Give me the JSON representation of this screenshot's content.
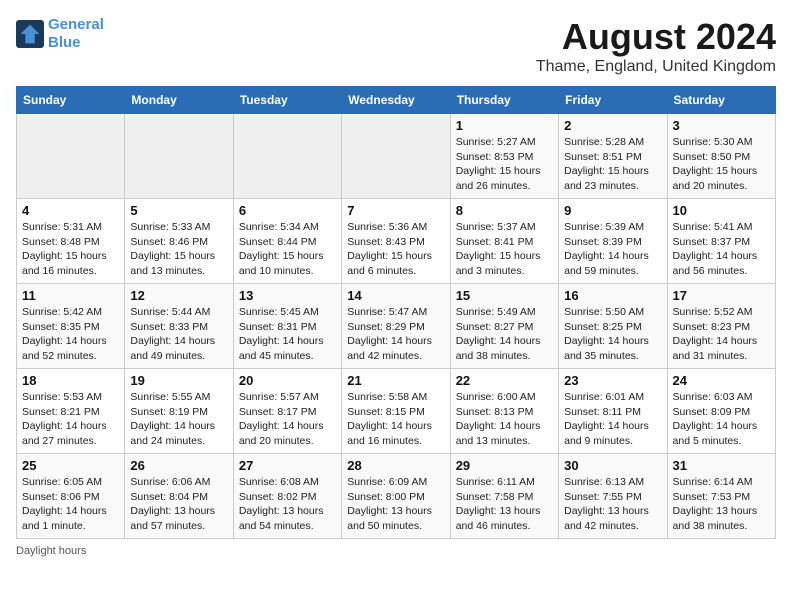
{
  "logo": {
    "line1": "General",
    "line2": "Blue"
  },
  "title": "August 2024",
  "subtitle": "Thame, England, United Kingdom",
  "days_of_week": [
    "Sunday",
    "Monday",
    "Tuesday",
    "Wednesday",
    "Thursday",
    "Friday",
    "Saturday"
  ],
  "footer": "Daylight hours",
  "weeks": [
    [
      {
        "day": "",
        "info": ""
      },
      {
        "day": "",
        "info": ""
      },
      {
        "day": "",
        "info": ""
      },
      {
        "day": "",
        "info": ""
      },
      {
        "day": "1",
        "info": "Sunrise: 5:27 AM\nSunset: 8:53 PM\nDaylight: 15 hours\nand 26 minutes."
      },
      {
        "day": "2",
        "info": "Sunrise: 5:28 AM\nSunset: 8:51 PM\nDaylight: 15 hours\nand 23 minutes."
      },
      {
        "day": "3",
        "info": "Sunrise: 5:30 AM\nSunset: 8:50 PM\nDaylight: 15 hours\nand 20 minutes."
      }
    ],
    [
      {
        "day": "4",
        "info": "Sunrise: 5:31 AM\nSunset: 8:48 PM\nDaylight: 15 hours\nand 16 minutes."
      },
      {
        "day": "5",
        "info": "Sunrise: 5:33 AM\nSunset: 8:46 PM\nDaylight: 15 hours\nand 13 minutes."
      },
      {
        "day": "6",
        "info": "Sunrise: 5:34 AM\nSunset: 8:44 PM\nDaylight: 15 hours\nand 10 minutes."
      },
      {
        "day": "7",
        "info": "Sunrise: 5:36 AM\nSunset: 8:43 PM\nDaylight: 15 hours\nand 6 minutes."
      },
      {
        "day": "8",
        "info": "Sunrise: 5:37 AM\nSunset: 8:41 PM\nDaylight: 15 hours\nand 3 minutes."
      },
      {
        "day": "9",
        "info": "Sunrise: 5:39 AM\nSunset: 8:39 PM\nDaylight: 14 hours\nand 59 minutes."
      },
      {
        "day": "10",
        "info": "Sunrise: 5:41 AM\nSunset: 8:37 PM\nDaylight: 14 hours\nand 56 minutes."
      }
    ],
    [
      {
        "day": "11",
        "info": "Sunrise: 5:42 AM\nSunset: 8:35 PM\nDaylight: 14 hours\nand 52 minutes."
      },
      {
        "day": "12",
        "info": "Sunrise: 5:44 AM\nSunset: 8:33 PM\nDaylight: 14 hours\nand 49 minutes."
      },
      {
        "day": "13",
        "info": "Sunrise: 5:45 AM\nSunset: 8:31 PM\nDaylight: 14 hours\nand 45 minutes."
      },
      {
        "day": "14",
        "info": "Sunrise: 5:47 AM\nSunset: 8:29 PM\nDaylight: 14 hours\nand 42 minutes."
      },
      {
        "day": "15",
        "info": "Sunrise: 5:49 AM\nSunset: 8:27 PM\nDaylight: 14 hours\nand 38 minutes."
      },
      {
        "day": "16",
        "info": "Sunrise: 5:50 AM\nSunset: 8:25 PM\nDaylight: 14 hours\nand 35 minutes."
      },
      {
        "day": "17",
        "info": "Sunrise: 5:52 AM\nSunset: 8:23 PM\nDaylight: 14 hours\nand 31 minutes."
      }
    ],
    [
      {
        "day": "18",
        "info": "Sunrise: 5:53 AM\nSunset: 8:21 PM\nDaylight: 14 hours\nand 27 minutes."
      },
      {
        "day": "19",
        "info": "Sunrise: 5:55 AM\nSunset: 8:19 PM\nDaylight: 14 hours\nand 24 minutes."
      },
      {
        "day": "20",
        "info": "Sunrise: 5:57 AM\nSunset: 8:17 PM\nDaylight: 14 hours\nand 20 minutes."
      },
      {
        "day": "21",
        "info": "Sunrise: 5:58 AM\nSunset: 8:15 PM\nDaylight: 14 hours\nand 16 minutes."
      },
      {
        "day": "22",
        "info": "Sunrise: 6:00 AM\nSunset: 8:13 PM\nDaylight: 14 hours\nand 13 minutes."
      },
      {
        "day": "23",
        "info": "Sunrise: 6:01 AM\nSunset: 8:11 PM\nDaylight: 14 hours\nand 9 minutes."
      },
      {
        "day": "24",
        "info": "Sunrise: 6:03 AM\nSunset: 8:09 PM\nDaylight: 14 hours\nand 5 minutes."
      }
    ],
    [
      {
        "day": "25",
        "info": "Sunrise: 6:05 AM\nSunset: 8:06 PM\nDaylight: 14 hours\nand 1 minute."
      },
      {
        "day": "26",
        "info": "Sunrise: 6:06 AM\nSunset: 8:04 PM\nDaylight: 13 hours\nand 57 minutes."
      },
      {
        "day": "27",
        "info": "Sunrise: 6:08 AM\nSunset: 8:02 PM\nDaylight: 13 hours\nand 54 minutes."
      },
      {
        "day": "28",
        "info": "Sunrise: 6:09 AM\nSunset: 8:00 PM\nDaylight: 13 hours\nand 50 minutes."
      },
      {
        "day": "29",
        "info": "Sunrise: 6:11 AM\nSunset: 7:58 PM\nDaylight: 13 hours\nand 46 minutes."
      },
      {
        "day": "30",
        "info": "Sunrise: 6:13 AM\nSunset: 7:55 PM\nDaylight: 13 hours\nand 42 minutes."
      },
      {
        "day": "31",
        "info": "Sunrise: 6:14 AM\nSunset: 7:53 PM\nDaylight: 13 hours\nand 38 minutes."
      }
    ]
  ]
}
